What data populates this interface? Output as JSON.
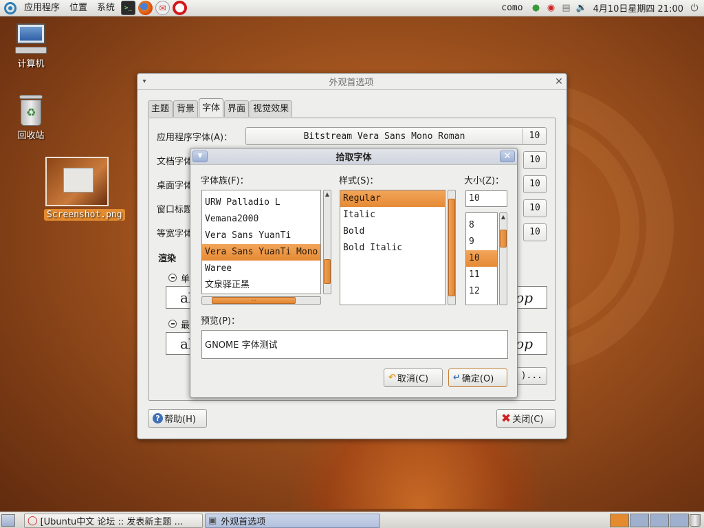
{
  "top_panel": {
    "menus": [
      "应用程序",
      "位置",
      "系统"
    ],
    "user": "como",
    "clock": "4月10日星期四 21:00"
  },
  "desktop": {
    "icons": [
      {
        "label": "计算机"
      },
      {
        "label": "回收站"
      },
      {
        "label": "Screenshot.png"
      }
    ]
  },
  "prefs_window": {
    "title": "外观首选项",
    "tabs": [
      "主题",
      "背景",
      "字体",
      "界面",
      "视觉效果"
    ],
    "active_tab": "字体",
    "font_rows": [
      {
        "label": "应用程序字体(A)：",
        "font": "Bitstream Vera Sans Mono Roman",
        "size": "10"
      },
      {
        "label": "文档字体",
        "size": "10"
      },
      {
        "label": "桌面字体",
        "size": "10"
      },
      {
        "label": "窗口标题",
        "size": "10"
      },
      {
        "label": "等宽字体",
        "size": "10"
      }
    ],
    "rendering": {
      "title": "渲染",
      "option_1": "单",
      "option_2": "最",
      "sample_left": "al",
      "sample_right": "op"
    },
    "details_tail": ")...",
    "help_button": "帮助(H)",
    "close_button": "关闭(C)"
  },
  "font_picker": {
    "title": "拾取字体",
    "family_label": "字体族(F)：",
    "families": [
      "URW Palladio L",
      "Vemana2000",
      "Vera Sans YuanTi",
      "Vera Sans YuanTi Mono",
      "Waree",
      "文泉驿正黑"
    ],
    "selected_family": "Vera Sans YuanTi Mono",
    "style_label": "样式(S)：",
    "styles": [
      "Regular",
      "Italic",
      "Bold",
      "Bold Italic"
    ],
    "selected_style": "Regular",
    "size_label": "大小(Z)：",
    "size_value": "10",
    "sizes": [
      "8",
      "9",
      "10",
      "11",
      "12"
    ],
    "selected_size": "10",
    "preview_label": "预览(P)：",
    "preview_text": "GNOME 字体测试",
    "cancel_button": "取消(C)",
    "ok_button": "确定(O)",
    "hscroll_glyph": "⋯"
  },
  "bottom_panel": {
    "tasks": [
      {
        "label": "[Ubuntu中文 论坛 :: 发表新主题 …"
      },
      {
        "label": "外观首选项"
      }
    ]
  },
  "colors": {
    "accent": "#e58a35",
    "selection": "#f2a55a",
    "desktop": "#a3551f"
  }
}
